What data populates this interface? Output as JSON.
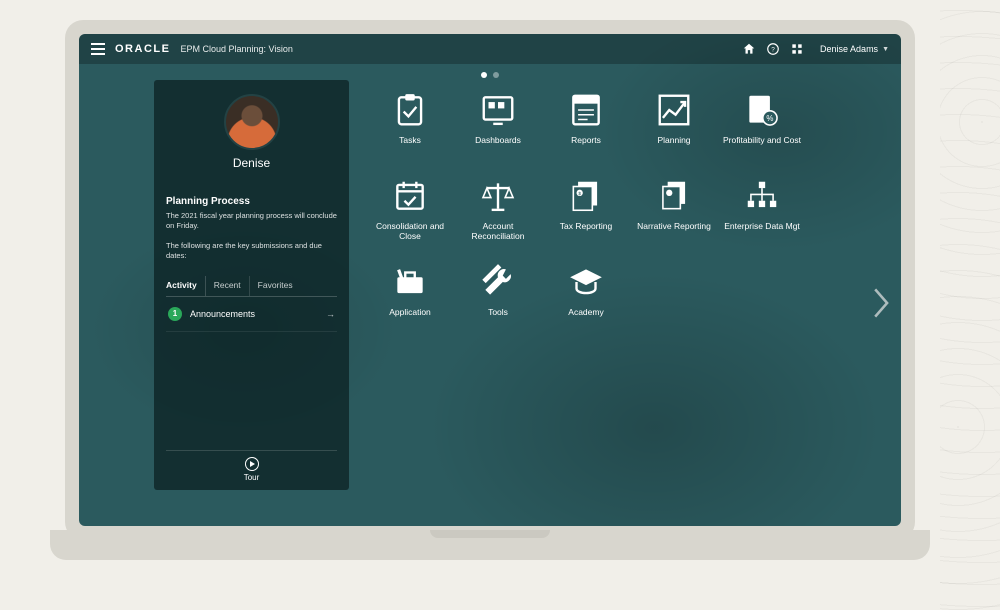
{
  "header": {
    "brand": "ORACLE",
    "product": "EPM Cloud Planning:",
    "environment": "Vision",
    "user": "Denise Adams"
  },
  "panel": {
    "username": "Denise",
    "announce_title": "Planning Process",
    "announce_line1": "The 2021 fiscal year planning process will conclude on Friday.",
    "announce_line2": "The following are the key submissions and due dates:",
    "tabs": {
      "activity": "Activity",
      "recent": "Recent",
      "favorites": "Favorites"
    },
    "activity_badge": "1",
    "activity_label": "Announcements",
    "tour_label": "Tour"
  },
  "cards": {
    "c0": "Tasks",
    "c1": "Dashboards",
    "c2": "Reports",
    "c3": "Planning",
    "c4": "Profitability and Cost",
    "c5": "Consolidation and Close",
    "c6": "Account Reconciliation",
    "c7": "Tax Reporting",
    "c8": "Narrative Reporting",
    "c9": "Enterprise Data Mgt",
    "c10": "Application",
    "c11": "Tools",
    "c12": "Academy"
  }
}
